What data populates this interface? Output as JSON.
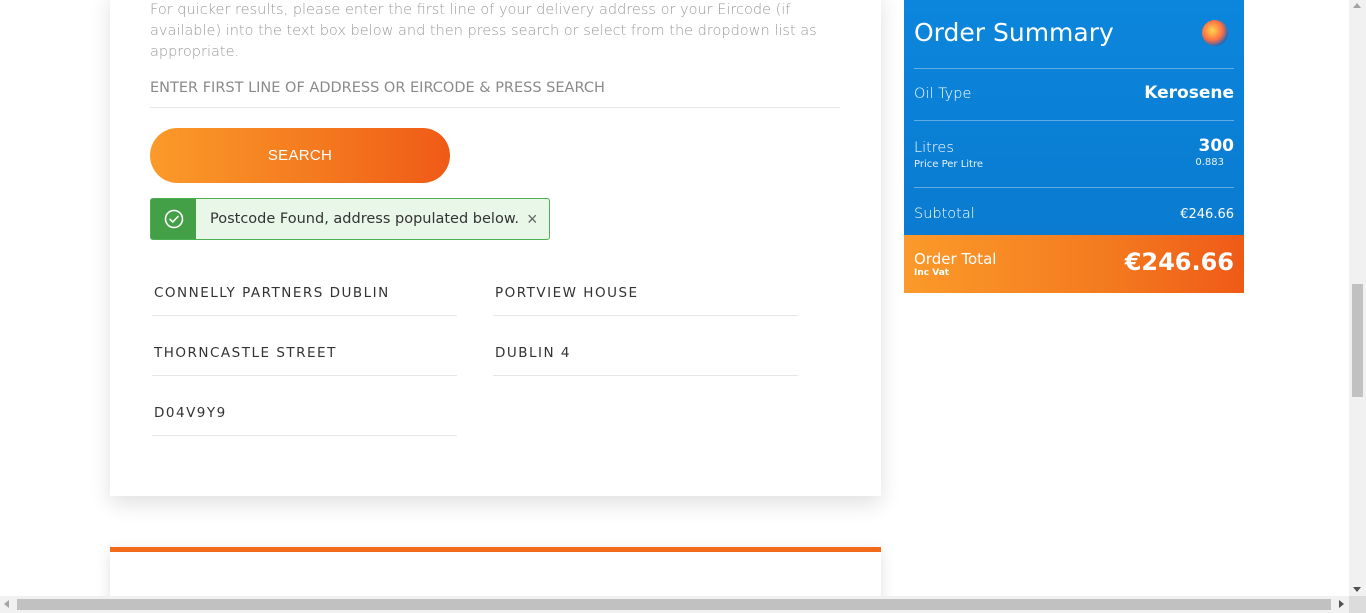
{
  "address_section": {
    "intro_text": "For quicker results, please enter the first line of your delivery address or your Eircode (if available) into the text box below and then press search or select from the dropdown list as appropriate.",
    "input_placeholder": "ENTER FIRST LINE OF ADDRESS OR EIRCODE & PRESS SEARCH",
    "input_value": "",
    "search_label": "SEARCH",
    "alert": {
      "text": "Postcode Found, address populated below.",
      "icon": "check-circle-icon",
      "close": "×"
    },
    "fields": {
      "line1": "CONNELLY PARTNERS DUBLIN",
      "line2": "PORTVIEW HOUSE",
      "line3": "THORNCASTLE STREET",
      "line4": "DUBLIN 4",
      "eircode": "D04V9Y9"
    }
  },
  "order_summary": {
    "title": "Order Summary",
    "oil_type_label": "Oil Type",
    "oil_type_value": "Kerosene",
    "litres_label": "Litres",
    "litres_value": "300",
    "price_per_litre_label": "Price Per Litre",
    "price_per_litre_value": "0.883",
    "subtotal_label": "Subtotal",
    "subtotal_value": "€246.66",
    "total_label": "Order Total",
    "total_sub": "Inc Vat",
    "total_value": "€246.66"
  },
  "colors": {
    "accent_orange": "#f47a1f",
    "summary_blue": "#0a7bd0",
    "success_green": "#43a047"
  }
}
